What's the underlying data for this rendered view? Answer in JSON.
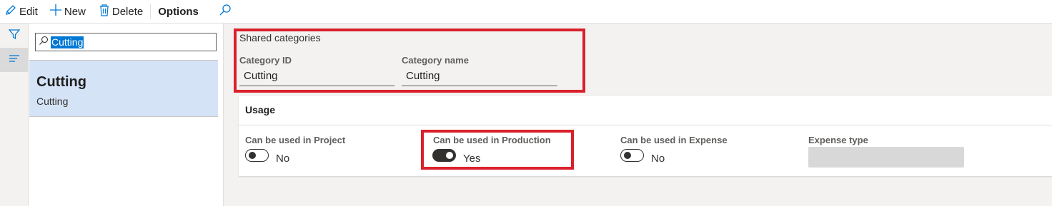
{
  "toolbar": {
    "edit_label": "Edit",
    "new_label": "New",
    "delete_label": "Delete",
    "options_label": "Options"
  },
  "rail": {
    "filter_icon": "filter-icon",
    "list_icon": "list-icon"
  },
  "list": {
    "search_value": "Cutting",
    "items": [
      {
        "title": "Cutting",
        "subtitle": "Cutting"
      }
    ]
  },
  "details": {
    "group_title": "Shared categories",
    "category_id_label": "Category ID",
    "category_id_value": "Cutting",
    "category_name_label": "Category name",
    "category_name_value": "Cutting"
  },
  "usage": {
    "title": "Usage",
    "project_label": "Can be used in Project",
    "project_value": "No",
    "production_label": "Can be used in Production",
    "production_value": "Yes",
    "expense_label": "Can be used in Expense",
    "expense_value": "No",
    "expense_type_label": "Expense type"
  },
  "colors": {
    "highlight_border": "#d9202b",
    "selected_item": "#d5e3f7",
    "accent": "#0078d4"
  }
}
